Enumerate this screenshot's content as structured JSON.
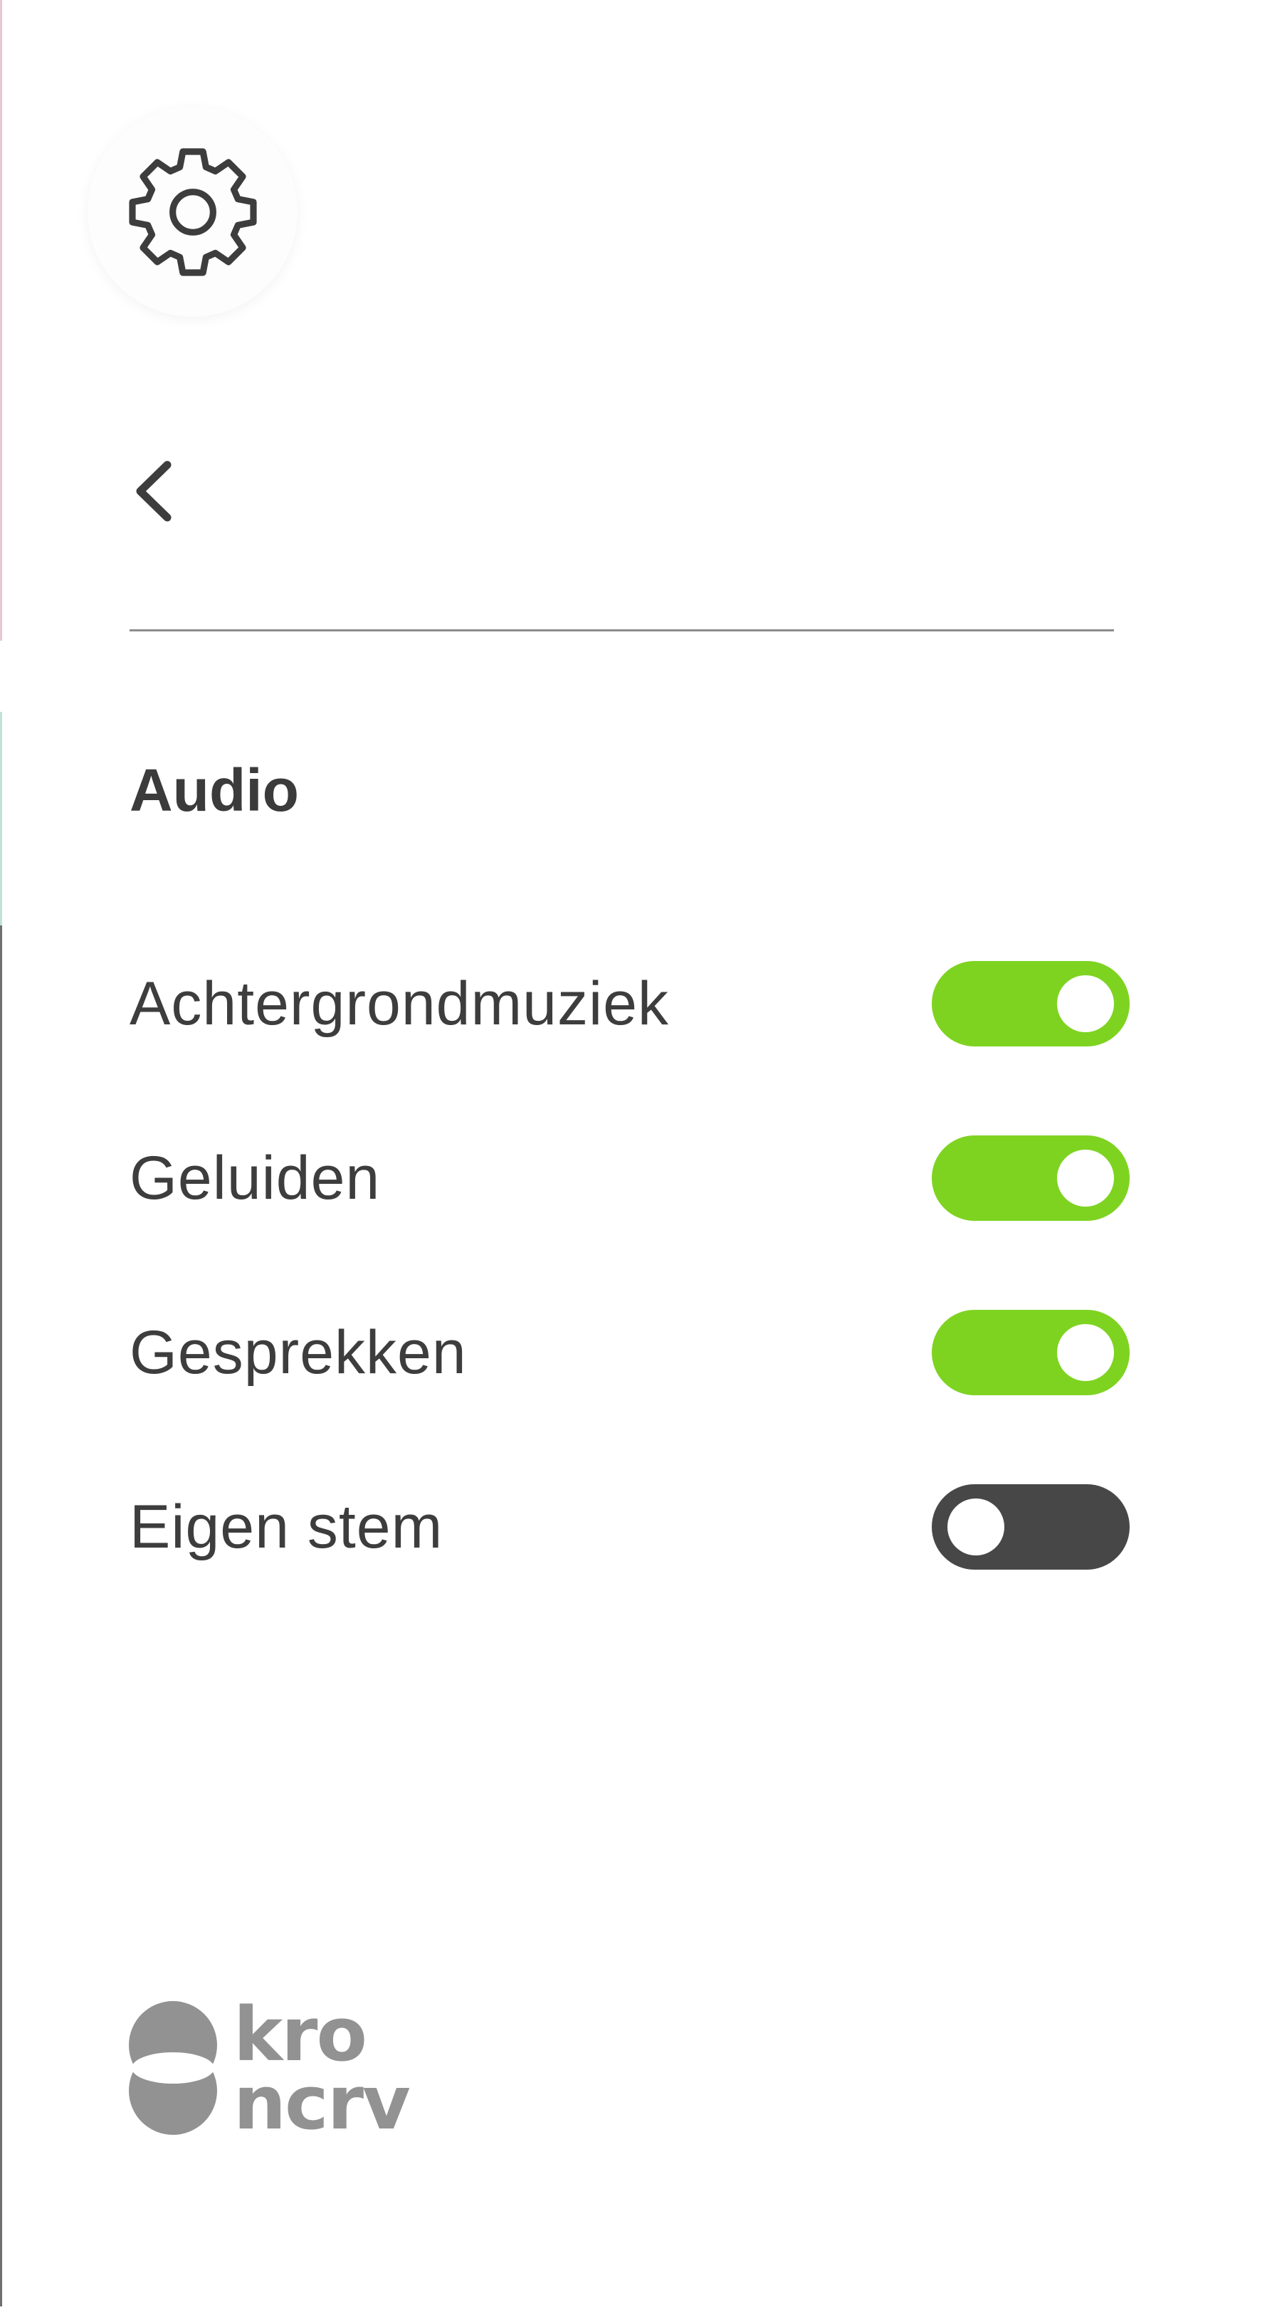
{
  "header": {
    "settings_icon": "gear-icon",
    "back_icon": "chevron-left-icon"
  },
  "section": {
    "title": "Audio"
  },
  "settings": [
    {
      "label": "Achtergrondmuziek",
      "enabled": true
    },
    {
      "label": "Geluiden",
      "enabled": true
    },
    {
      "label": "Gesprekken",
      "enabled": true
    },
    {
      "label": "Eigen stem",
      "enabled": false
    }
  ],
  "brand": {
    "logo_line1": "kro",
    "logo_line2": "ncrv"
  },
  "colors": {
    "toggle_on": "#7ed321",
    "toggle_off": "#474747",
    "text": "#3d3d3d",
    "logo": "#929292"
  }
}
